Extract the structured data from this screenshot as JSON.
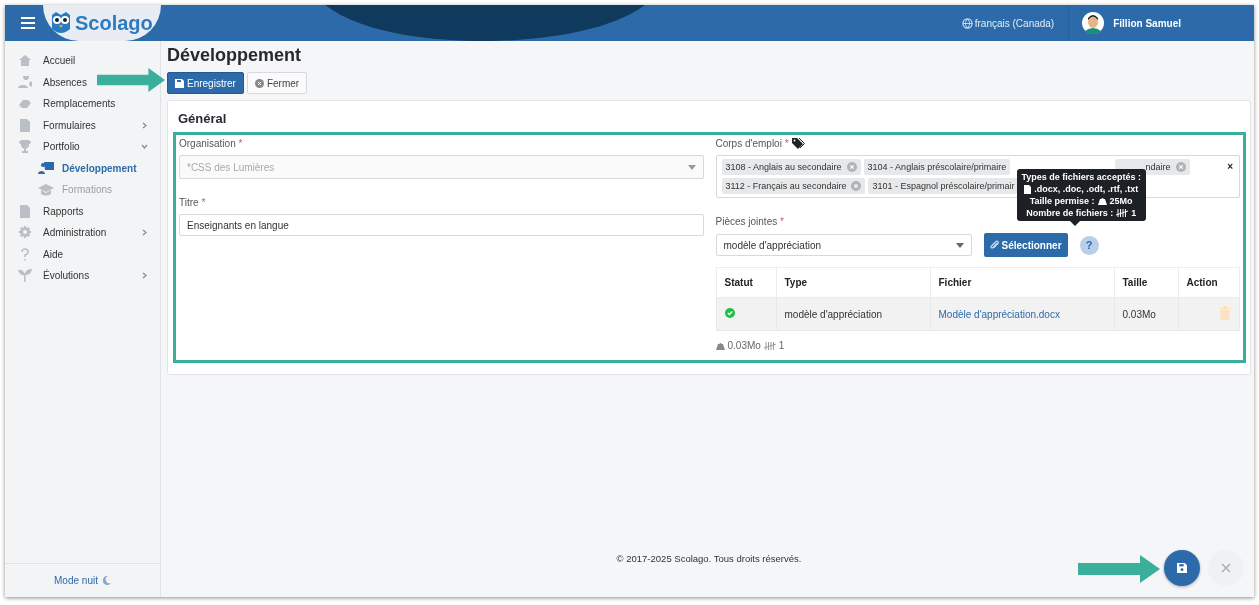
{
  "header": {
    "logo": "Scolago",
    "language": "français (Canada)",
    "user": "Fillion Samuel"
  },
  "sidebar": {
    "items": [
      {
        "label": "Accueil",
        "selected": false
      },
      {
        "label": "Absences",
        "selected": false
      },
      {
        "label": "Remplacements",
        "selected": false
      },
      {
        "label": "Formulaires",
        "selected": false,
        "expanded": false
      },
      {
        "label": "Portfolio",
        "selected": false,
        "expanded": true,
        "children": [
          {
            "label": "Développement",
            "selected": true
          },
          {
            "label": "Formations",
            "selected": false
          }
        ]
      },
      {
        "label": "Rapports",
        "selected": false
      },
      {
        "label": "Administration",
        "selected": false,
        "expanded": false
      },
      {
        "label": "Aide",
        "selected": false
      },
      {
        "label": "Évolutions",
        "selected": false,
        "expanded": false
      }
    ],
    "footer": "Mode nuit"
  },
  "page": {
    "title": "Développement",
    "toolbar": [
      {
        "label": "Enregistrer",
        "kind": "primary"
      },
      {
        "label": "Fermer",
        "kind": "secondary"
      }
    ],
    "card": {
      "title": "Général",
      "organisation": {
        "label": "Organisation",
        "mark": "*",
        "placeholder": "*CSS des Lumières"
      },
      "titre": {
        "label": "Titre",
        "mark": "*",
        "value": "Enseignants en langue"
      },
      "corps": {
        "label": "Corps d'emploi",
        "mark": "*",
        "tags": [
          {
            "label": "3108 - Anglais au secondaire"
          },
          {
            "label": "3104 - Anglais préscolaire/primaire"
          },
          {
            "label": "ndaire"
          },
          {
            "label": "3112 - Français au secondaire"
          },
          {
            "label": "3101 - Espagnol préscolaire/primair"
          }
        ],
        "clear": "×"
      },
      "pieces": {
        "label": "Pièces jointes",
        "mark": "*",
        "value": "modèle d'appréciation",
        "button": "Sélectionner",
        "help": "?"
      },
      "tooltip": {
        "title": "Types de fichiers acceptés :",
        "types": ".docx, .doc, .odt, .rtf, .txt",
        "size_label": "Taille permise :",
        "size": "25Mo",
        "count_label": "Nombre de fichiers :",
        "count": "1"
      },
      "table": {
        "columns": [
          "Statut",
          "Type",
          "Fichier",
          "Taille",
          "Action"
        ],
        "rows": [
          {
            "ok": true,
            "type": "modèle d'appréciation",
            "file": "Modèle d'appréciation.docx",
            "size": "0.03Mo"
          }
        ]
      },
      "summary": {
        "size": "0.03Mo",
        "count": "1"
      }
    }
  },
  "footer": "© 2017-2025 Scolago. Tous droits réservés."
}
